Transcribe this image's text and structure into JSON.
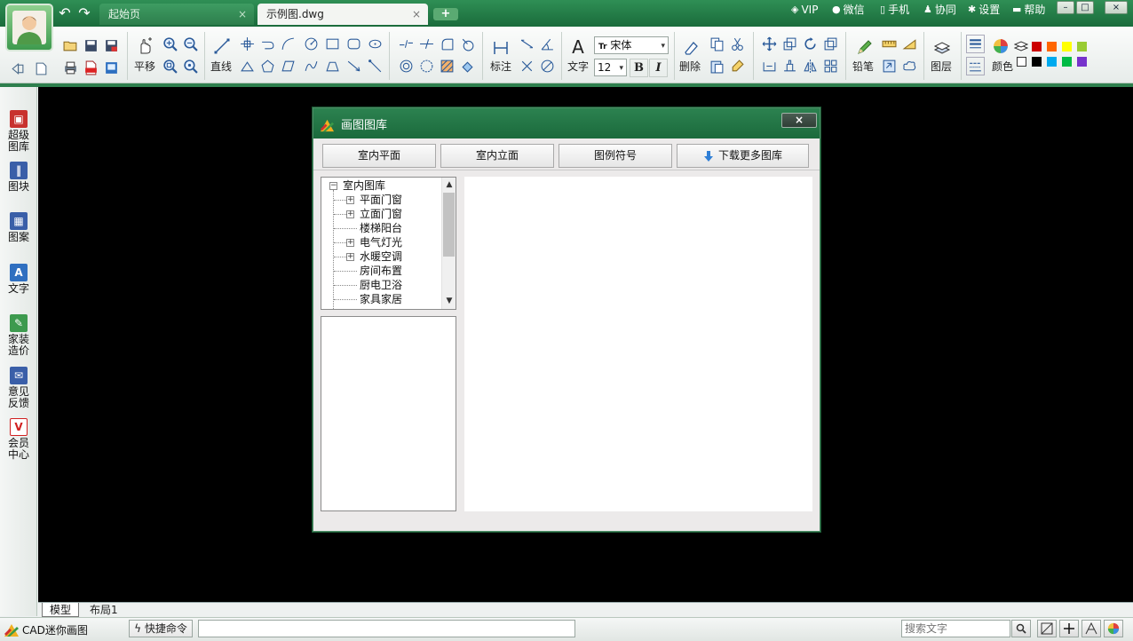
{
  "titlebar": {
    "tabs": [
      {
        "label": "起始页",
        "close": "×"
      },
      {
        "label": "示例图.dwg",
        "close": "×"
      }
    ],
    "add_tab": "+",
    "links": [
      {
        "label": "VIP",
        "icon": "diamond-icon"
      },
      {
        "label": "微信",
        "icon": "wechat-icon"
      },
      {
        "label": "手机",
        "icon": "phone-icon"
      },
      {
        "label": "协同",
        "icon": "user-icon"
      },
      {
        "label": "设置",
        "icon": "gear-icon"
      },
      {
        "label": "帮助",
        "icon": "help-icon"
      }
    ],
    "window_buttons": [
      "–",
      "□",
      "×"
    ]
  },
  "toolbar": {
    "pan_label": "平移",
    "line_label": "直线",
    "dimension_label": "标注",
    "text_label": "文字",
    "font_value": "宋体",
    "font_icon_text": "Tr",
    "size_value": "12",
    "bold": "B",
    "italic": "I",
    "delete_label": "删除",
    "pencil_label": "铅笔",
    "layer_label": "图层",
    "color_label": "颜色",
    "colors_row1": [
      "#cc0000",
      "#ff6600",
      "#ffff00",
      "#99cc33"
    ],
    "colors_row2": [
      "#000000",
      "#00aaee",
      "#00bb44",
      "#7733cc"
    ]
  },
  "sidebar": {
    "items": [
      {
        "label": "超级图库",
        "icon": "gallery-icon",
        "color": "#c8322e"
      },
      {
        "label": "图块",
        "icon": "blocks-icon",
        "color": "#3a5fa8"
      },
      {
        "label": "图案",
        "icon": "pattern-icon",
        "color": "#3a5fa8"
      },
      {
        "label": "文字",
        "icon": "text-icon",
        "color": "#2f6fc0"
      },
      {
        "label": "家装造价",
        "icon": "pencil-ruler-icon",
        "color": "#3d9a4e"
      },
      {
        "label": "意见反馈",
        "icon": "mail-icon",
        "color": "#3a5fa8"
      },
      {
        "label": "会员中心",
        "icon": "vip-icon",
        "color": "#d02020"
      }
    ]
  },
  "layout_tabs": {
    "model": "模型",
    "layout": "布局1"
  },
  "statusbar": {
    "app_name": "CAD迷你画图",
    "quick_cmd": "快捷命令",
    "search_placeholder": "搜索文字"
  },
  "dialog": {
    "title": "画图图库",
    "close": "×",
    "tabs": [
      "室内平面",
      "室内立面",
      "图例符号"
    ],
    "download": "下载更多图库",
    "tree": {
      "root": "室内图库",
      "root_toggle": "−",
      "expand_toggle": "+",
      "children": [
        {
          "label": "平面门窗",
          "expandable": true
        },
        {
          "label": "立面门窗",
          "expandable": true
        },
        {
          "label": "楼梯阳台",
          "expandable": false
        },
        {
          "label": "电气灯光",
          "expandable": true
        },
        {
          "label": "水暖空调",
          "expandable": true
        },
        {
          "label": "房间布置",
          "expandable": false
        },
        {
          "label": "厨电卫浴",
          "expandable": false
        },
        {
          "label": "家具家居",
          "expandable": false
        }
      ]
    }
  }
}
